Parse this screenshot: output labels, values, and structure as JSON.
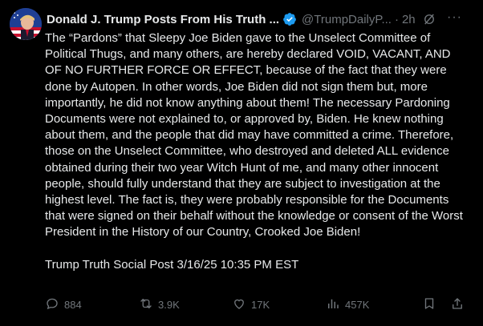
{
  "post": {
    "author_name": "Donald J. Trump Posts From His Truth ...",
    "handle": "@TrumpDailyP...",
    "separator": "·",
    "time": "2h",
    "more_label": "···",
    "body": "The “Pardons” that Sleepy Joe Biden gave to the Unselect Committee of Political Thugs, and many others, are hereby declared VOID, VACANT, AND OF NO FURTHER FORCE OR EFFECT, because of the fact that they were done by Autopen. In other words, Joe Biden did not sign them but, more importantly, he did not know anything about them! The necessary Pardoning Documents were not explained to, or approved by, Biden. He knew nothing about them, and the people that did may have committed a crime. Therefore, those on the Unselect Committee, who destroyed and deleted ALL evidence obtained during their two year Witch Hunt of me, and many other innocent people, should fully understand that they are subject to investigation at the highest level. The fact is, they were probably responsible for the Documents that were signed on their behalf without the knowledge or consent of the Worst President in the History of our Country, Crooked Joe Biden!",
    "signature": "Trump Truth Social Post 3/16/25 10:35 PM EST"
  },
  "actions": {
    "replies": "884",
    "reposts": "3.9K",
    "likes": "17K",
    "views": "457K"
  },
  "icons": {
    "verified": "verified-badge-icon",
    "grok": "grok-icon",
    "reply": "reply-icon",
    "repost": "repost-icon",
    "like": "heart-icon",
    "views": "views-chart-icon",
    "bookmark": "bookmark-icon",
    "share": "share-icon"
  },
  "colors": {
    "background": "#000000",
    "text": "#e7e9ea",
    "muted": "#71767b",
    "verified": "#1d9bf0"
  }
}
